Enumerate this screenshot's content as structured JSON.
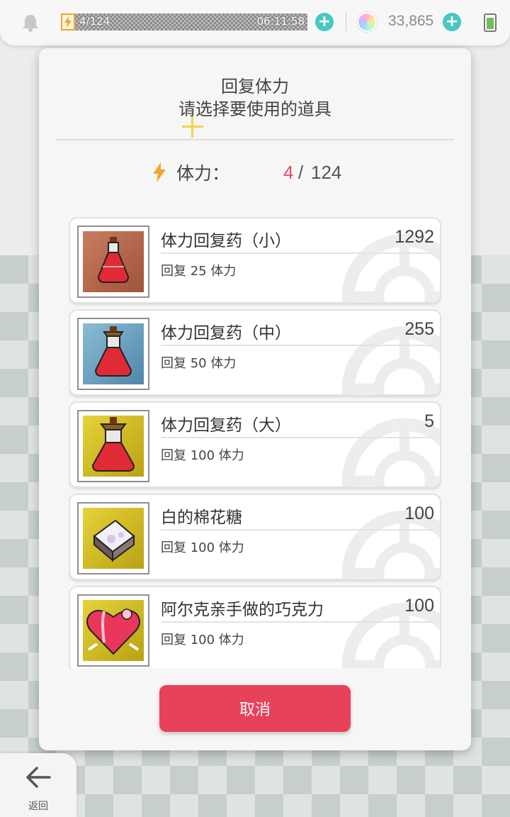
{
  "status_bar": {
    "stamina_value": "4/124",
    "timer": "06:11:58",
    "currency": "33,865"
  },
  "dialog": {
    "title": "回复体力",
    "subtitle": "请选择要使用的道具",
    "stamina_label": "体力：",
    "stamina_current": "4",
    "stamina_separator": "/",
    "stamina_max": "124",
    "items": [
      {
        "name": "体力回复药（小）",
        "count": "1292",
        "desc": "回复 25 体力",
        "icon": "potion-small-icon",
        "bg": "#b5674a"
      },
      {
        "name": "体力回复药（中）",
        "count": "255",
        "desc": "回复 50 体力",
        "icon": "potion-medium-icon",
        "bg": "#6a9fbf"
      },
      {
        "name": "体力回复药（大）",
        "count": "5",
        "desc": "回复 100 体力",
        "icon": "potion-large-icon",
        "bg": "#d9c21c"
      },
      {
        "name": "白的棉花糖",
        "count": "100",
        "desc": "回复 100 体力",
        "icon": "marshmallow-icon",
        "bg": "#d9c21c"
      },
      {
        "name": "阿尔克亲手做的巧克力",
        "count": "100",
        "desc": "回复 100 体力",
        "icon": "heart-chocolate-icon",
        "bg": "#d9c21c"
      }
    ],
    "cancel_label": "取消"
  },
  "back_button": {
    "label": "返回"
  },
  "colors": {
    "accent": "#e8415a",
    "stamina_current": "#e84a5f",
    "plus_button": "#49c8c2",
    "bolt": "#f2a52a"
  }
}
